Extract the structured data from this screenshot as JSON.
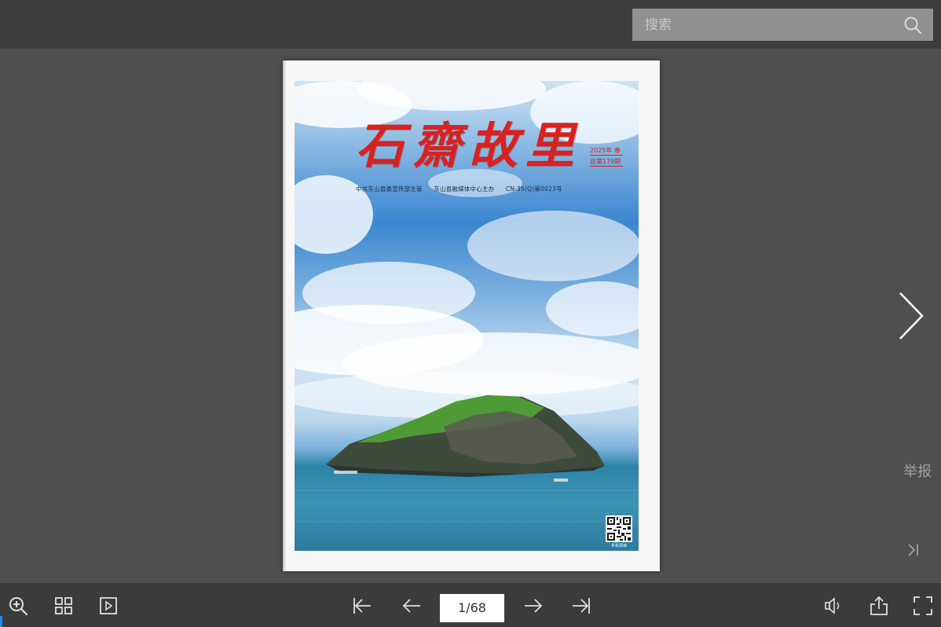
{
  "search": {
    "placeholder": "搜索",
    "icon": "search-icon"
  },
  "cover": {
    "title": "石齋故里",
    "issue_lines": [
      "2025年 春",
      "总第179期"
    ],
    "credits": [
      "中共东山县委宣传部主管",
      "东山县融媒体中心主办",
      "CN-35(Q)第0023号"
    ],
    "qr_caption": "手机阅读"
  },
  "side": {
    "report_label": "举报",
    "next_icon": "chevron-right-icon",
    "last_icon": "skip-to-end-icon"
  },
  "toolbar": {
    "zoom_icon": "zoom-in-icon",
    "grid_icon": "thumbnails-icon",
    "play_icon": "autoplay-icon",
    "first_icon": "first-page-icon",
    "prev_icon": "prev-page-icon",
    "page_indicator": "1/68",
    "next_icon": "next-page-icon",
    "last_icon": "last-page-icon",
    "sound_icon": "sound-icon",
    "share_icon": "share-icon",
    "fullscreen_icon": "fullscreen-icon"
  },
  "colors": {
    "title_red": "#d6231f",
    "background": "#4f4f4f",
    "toolbar": "#3b3b3b",
    "accent": "#1e88e5"
  }
}
